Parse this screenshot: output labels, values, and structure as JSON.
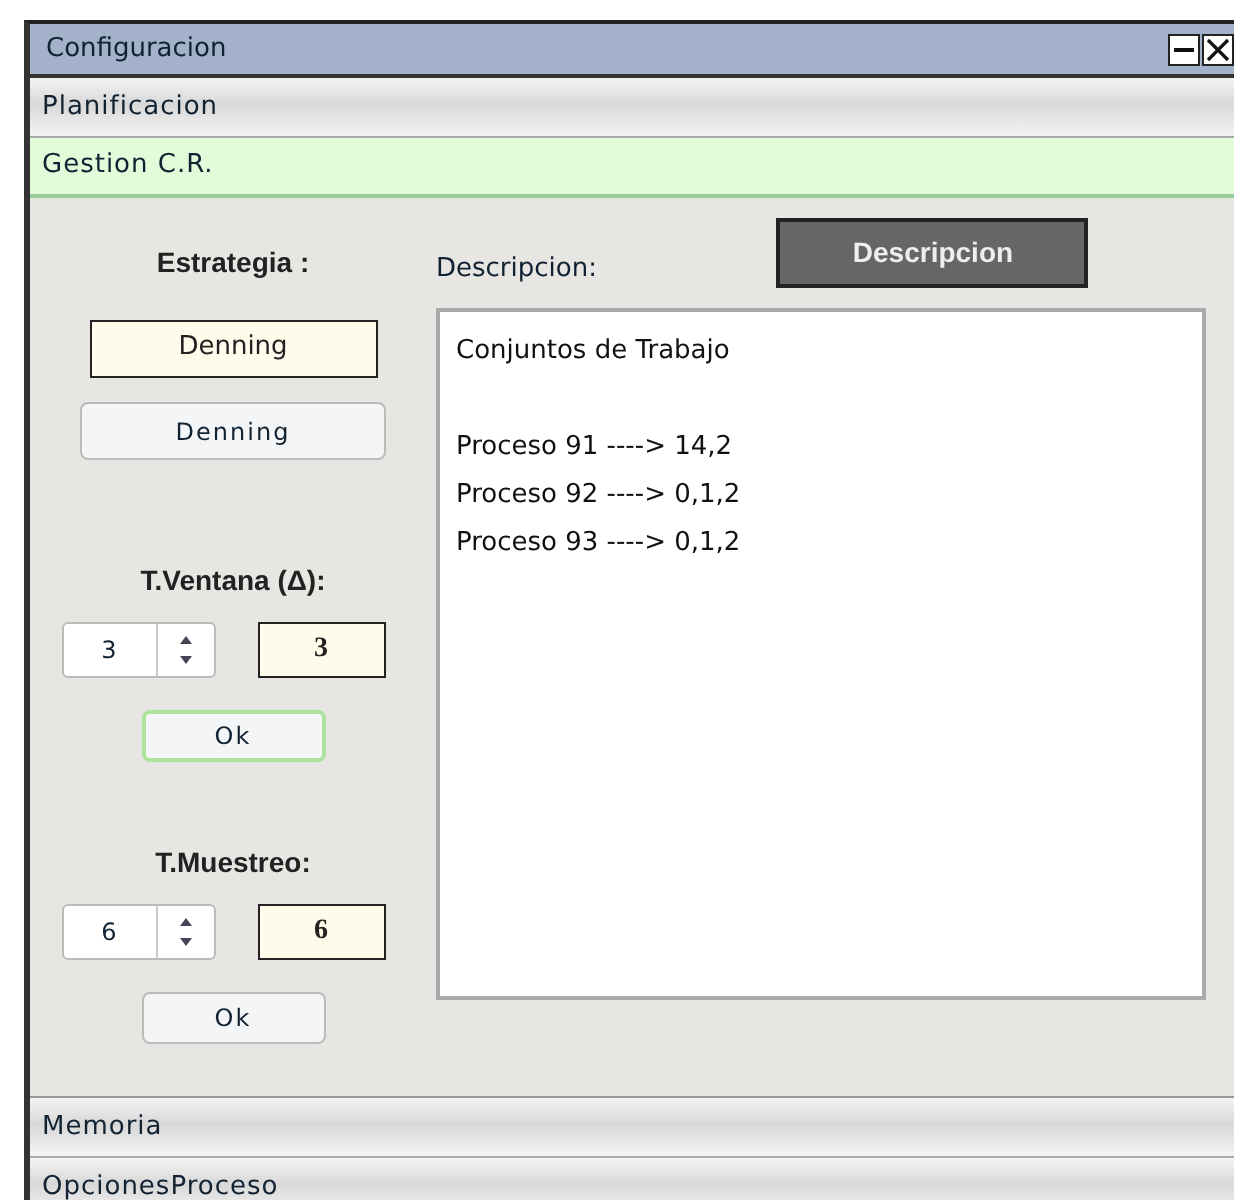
{
  "window": {
    "title": "Configuracion"
  },
  "sections": [
    {
      "label": "Planificacion",
      "selected": false
    },
    {
      "label": "Gestion C.R.",
      "selected": true
    },
    {
      "label": "Memoria",
      "selected": false
    },
    {
      "label": "OpcionesProceso",
      "selected": false
    }
  ],
  "panel": {
    "strategy": {
      "label": "Estrategia :",
      "value": "Denning",
      "button": "Denning"
    },
    "settings": [
      {
        "label": "T.Ventana (Δ):",
        "spinner": "3",
        "value": "3",
        "button": "Ok",
        "focused": true
      },
      {
        "label": "T.Muestreo:",
        "spinner": "6",
        "value": "6",
        "button": "Ok",
        "focused": false
      }
    ],
    "description": {
      "label": "Descripcion:",
      "button": "Descripcion",
      "heading": "Conjuntos de Trabajo",
      "lines": [
        "Proceso 91 ----> 14,2",
        "Proceso 92 ----> 0,1,2",
        "Proceso 93 ----> 0,1,2"
      ]
    }
  }
}
